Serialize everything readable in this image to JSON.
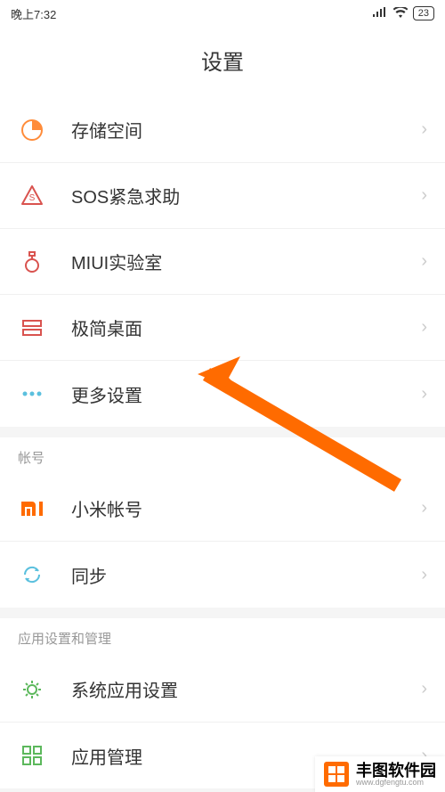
{
  "status": {
    "time": "晚上7:32",
    "battery": "23"
  },
  "header": {
    "title": "设置"
  },
  "items": [
    {
      "icon": "storage",
      "label": "存储空间"
    },
    {
      "icon": "sos",
      "label": "SOS紧急求助"
    },
    {
      "icon": "lab",
      "label": "MIUI实验室"
    },
    {
      "icon": "simple",
      "label": "极简桌面"
    },
    {
      "icon": "more",
      "label": "更多设置"
    }
  ],
  "sections": [
    {
      "title": "帐号",
      "items": [
        {
          "icon": "mi",
          "label": "小米帐号"
        },
        {
          "icon": "sync",
          "label": "同步"
        }
      ]
    },
    {
      "title": "应用设置和管理",
      "items": [
        {
          "icon": "gear",
          "label": "系统应用设置"
        },
        {
          "icon": "apps",
          "label": "应用管理"
        }
      ]
    }
  ],
  "watermark": {
    "text": "丰图软件园",
    "domain": "www.dgfengtu.com"
  },
  "colors": {
    "accent": "#ff6b00",
    "iconRed": "#d9534f",
    "iconBlue": "#5bc0de",
    "iconGreen": "#5cb85c",
    "iconOrange": "#ff6b00"
  }
}
